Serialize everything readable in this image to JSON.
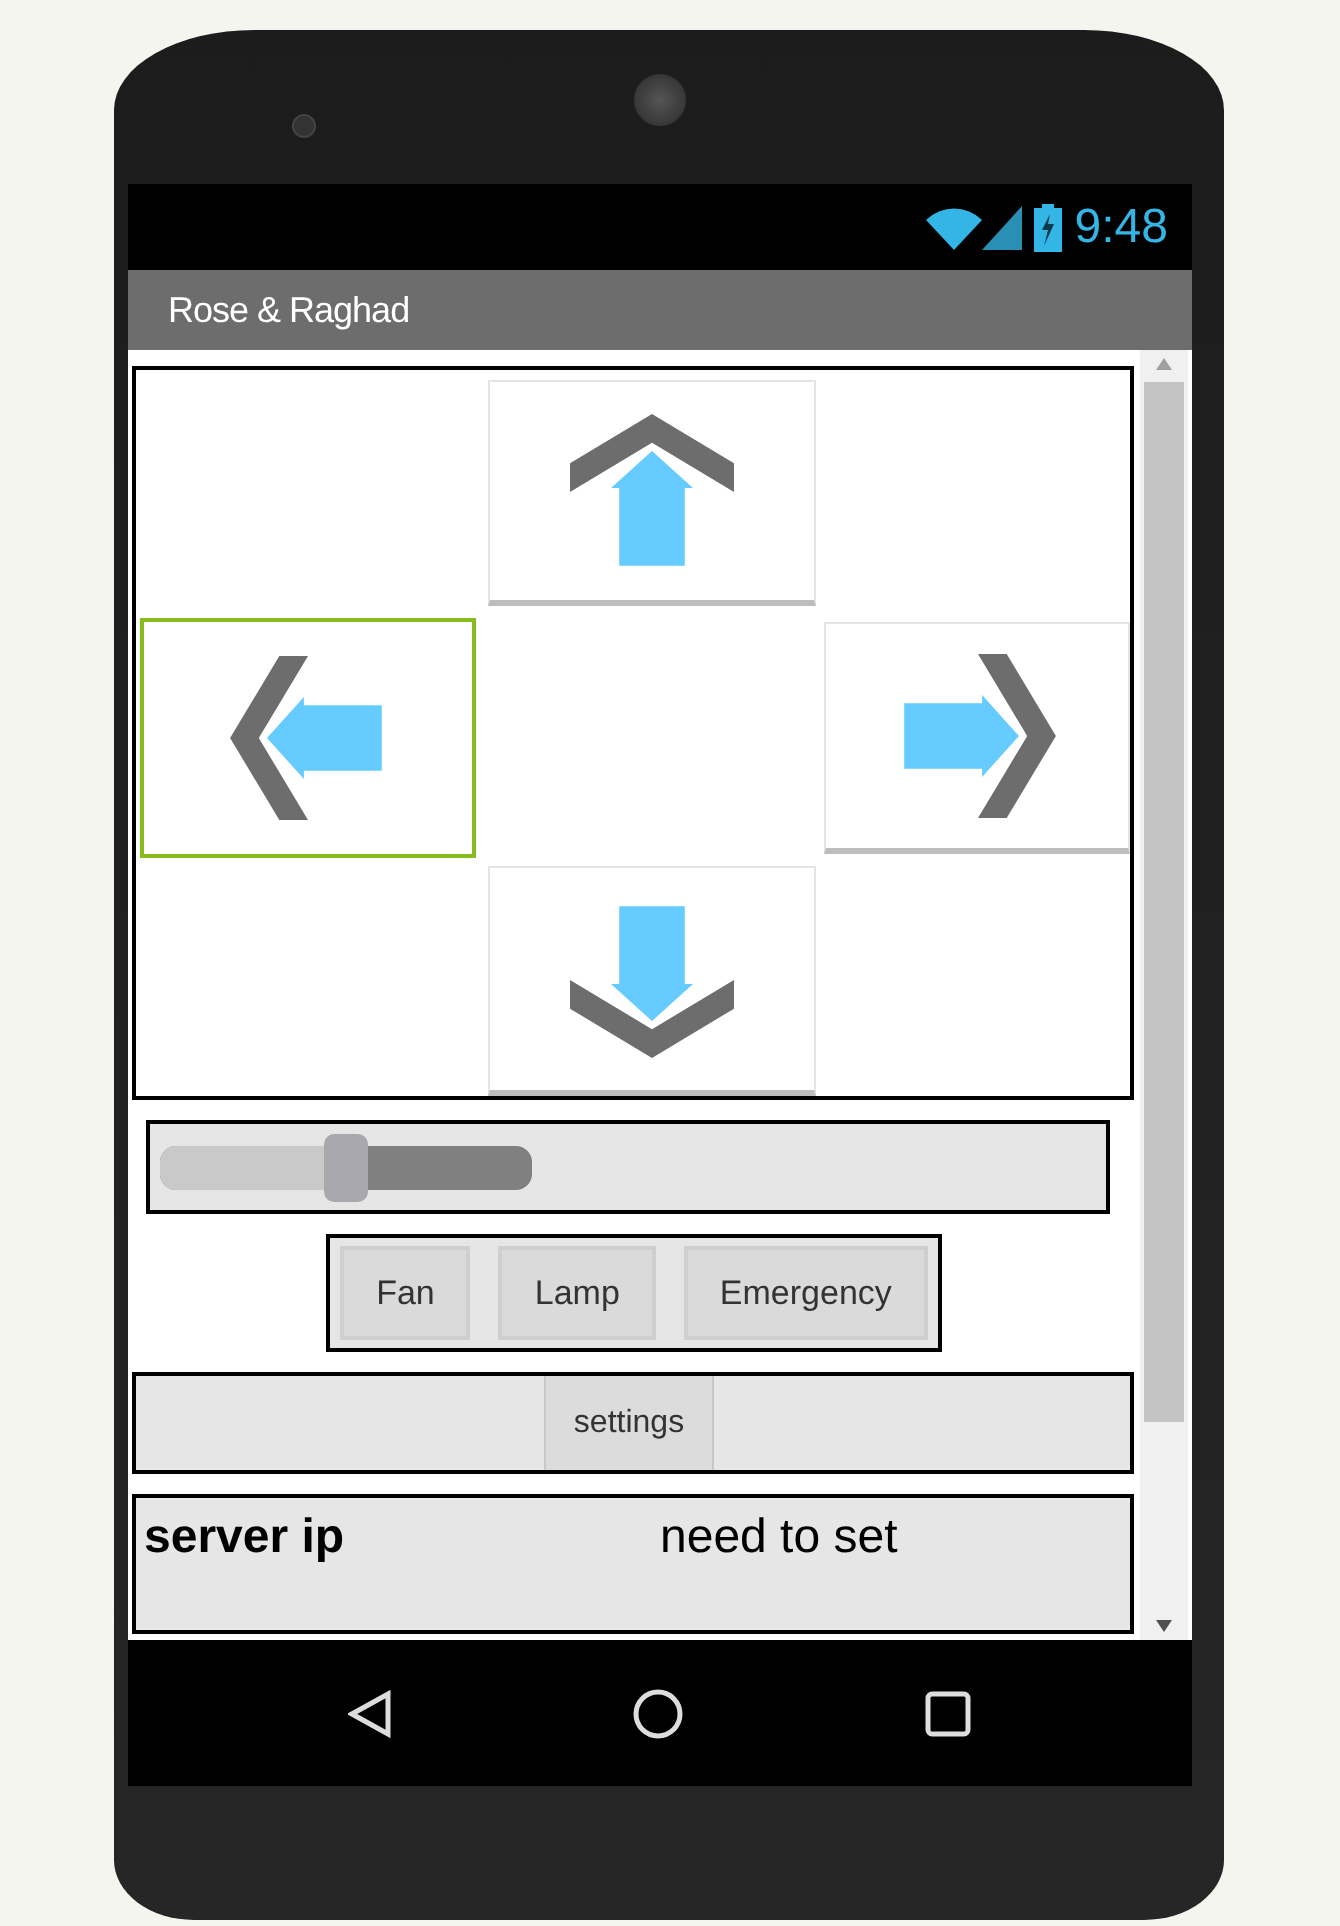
{
  "status_bar": {
    "time": "9:48"
  },
  "title_bar": {
    "title": "Rose & Raghad"
  },
  "direction_pad": [
    {
      "kind": "up",
      "selected": false
    },
    {
      "kind": "left",
      "selected": true
    },
    {
      "kind": "right",
      "selected": false
    },
    {
      "kind": "down",
      "selected": false
    }
  ],
  "slider": {
    "level": 0.5
  },
  "device_buttons": [
    "Fan",
    "Lamp",
    "Emergency"
  ],
  "settings_button": "settings",
  "server_row": {
    "label": "server ip",
    "value": "need to set"
  }
}
